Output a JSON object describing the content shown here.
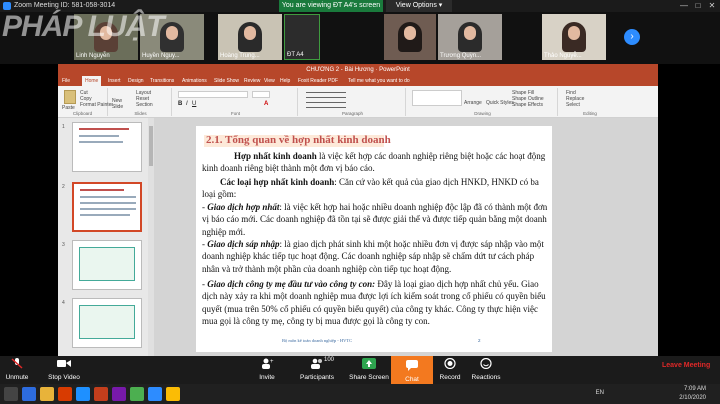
{
  "zoom": {
    "meeting_id": "Zoom Meeting ID: 581-058-3014",
    "viewing_banner": "You are viewing ĐT A4's screen",
    "view_options": "View Options ▾",
    "window_controls": [
      "—",
      "□",
      "✕"
    ]
  },
  "gallery": {
    "watermark": "PHÁP LUẬT",
    "participants": [
      "Linh Nguyễn",
      "Huyền Nguy...",
      "Hoàng Trung...",
      "ĐT A4",
      "",
      "Trương Quỳn...",
      "Thảo Nguyễ..."
    ],
    "next_icon": "chevron-right-icon"
  },
  "ppt": {
    "title": "CHƯƠNG 2 - Bài Hương · PowerPoint",
    "tabs": [
      "File",
      "Home",
      "Insert",
      "Design",
      "Transitions",
      "Animations",
      "Slide Show",
      "Review",
      "View",
      "Help",
      "Foxit Reader PDF",
      "Tell me what you want to do"
    ],
    "ribbon": {
      "clipboard": {
        "label": "Clipboard",
        "items": [
          "Paste",
          "Cut",
          "Copy",
          "Format Painter"
        ]
      },
      "slides": {
        "label": "Slides",
        "items": [
          "New Slide",
          "Layout",
          "Reset",
          "Section"
        ]
      },
      "font": {
        "label": "Font"
      },
      "paragraph": {
        "label": "Paragraph"
      },
      "drawing": {
        "label": "Drawing",
        "items": [
          "Arrange",
          "Quick Styles",
          "Shape Fill",
          "Shape Outline",
          "Shape Effects"
        ]
      },
      "editing": {
        "label": "Editing",
        "items": [
          "Find",
          "Replace",
          "Select"
        ]
      }
    },
    "thumb_numbers": [
      "1",
      "2",
      "3",
      "4"
    ],
    "slide": {
      "title": "2.1. Tổng quan về hợp nhất kinh doanh",
      "p1_bold": "Hợp nhất kinh doanh",
      "p1_rest": " là việc kết hợp các doanh nghiệp riêng biệt hoặc các hoạt động kinh doanh riêng biệt thành một đơn vị báo cáo.",
      "p2_bold": "Các loại hợp nhất kinh doanh",
      "p2_rest": ": Căn cứ vào kết quả của giao dịch HNKD, HNKD có ba loại gồm:",
      "p3_lead": "- ",
      "p3_bold": "Giao dịch hợp nhất",
      "p3_rest": ": là việc kết hợp hai hoặc nhiều doanh nghiệp độc lập đã có thành một đơn vị báo cáo mới. Các doanh nghiệp đã tồn tại sẽ được giải thể và được tiếp quản bằng một doanh nghiệp mới.",
      "p4_lead": "- ",
      "p4_bold": "Giao dịch sáp nhập",
      "p4_rest": ": là giao dịch phát sinh khi một hoặc nhiều đơn vị được sáp nhập vào một doanh nghiệp khác tiếp tục hoạt động. Các doanh nghiệp sáp nhập sẽ chấm dứt tư cách pháp nhân và trở thành một phần của doanh nghiệp còn tiếp tục hoạt động.",
      "p5_lead": "- ",
      "p5_bold": "Giao dịch công ty mẹ đầu tư vào công ty con:",
      "p5_rest": " Đây là loại giao dịch hợp nhất chủ yếu. Giao dịch này xảy ra khi một doanh nghiệp mua được lợi ích kiểm soát trong cổ phiếu có quyền biểu quyết (mua trên 50% cổ phiếu có quyền biểu quyết) của công ty khác. Công ty thực hiện việc mua gọi là công ty mẹ, công ty bị mua được gọi là công ty con.",
      "footer": "Bộ môn kế toán doanh nghiệp - HVTC",
      "page": "2"
    }
  },
  "controls": {
    "unmute": "Unmute",
    "stop_video": "Stop Video",
    "invite": "Invite",
    "participants": "Participants",
    "participants_count": "100",
    "share_screen": "Share Screen",
    "chat": "Chat",
    "record": "Record",
    "reactions": "Reactions",
    "leave": "Leave Meeting"
  },
  "taskbar": {
    "lang": "EN",
    "time": "7:09 AM",
    "date": "2/10/2020"
  },
  "colors": {
    "ppt_accent": "#b7472a",
    "zoom_green": "#1a7a3c",
    "zoom_blue": "#2d8cff",
    "chat_orange": "#f3791f",
    "leave_red": "#e02828"
  }
}
